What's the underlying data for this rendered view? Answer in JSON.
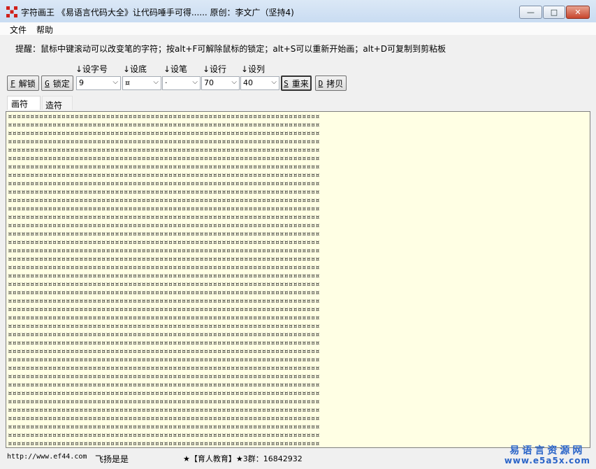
{
  "window": {
    "title": "字符画王 《易语言代码大全》让代码唾手可得...... 原创：李文广（坚持4)",
    "minimize_glyph": "—",
    "maximize_glyph": "□",
    "close_glyph": "✕"
  },
  "menu": {
    "items": [
      "文件",
      "帮助"
    ]
  },
  "hint": "提醒：鼠标中键滚动可以改变笔的字符；按alt+F可解除鼠标的锁定；alt+S可以重新开始画；alt+D可复制到剪粘板",
  "toolbar": {
    "unlock": {
      "key": "F",
      "label": "解锁"
    },
    "lock": {
      "key": "G",
      "label": "锁定"
    },
    "restart": {
      "key": "S",
      "label": "重来"
    },
    "copy": {
      "key": "D",
      "label": "拷贝"
    },
    "fields": [
      {
        "label": "↓设字号",
        "value": "9"
      },
      {
        "label": "↓设底",
        "value": "¤"
      },
      {
        "label": "↓设笔",
        "value": "·"
      },
      {
        "label": "↓设行",
        "value": "70"
      },
      {
        "label": "↓设列",
        "value": "40"
      }
    ],
    "arrow_glyph": "⌵"
  },
  "tabs": [
    "画符",
    "造符"
  ],
  "canvas": {
    "fill_char": "¤",
    "rows": 40,
    "cols": 70
  },
  "status": {
    "url": "http://www.ef44.com",
    "name": "飞扬是是",
    "group": "★【育人教育】★3群：16842932"
  },
  "watermark": {
    "cn": "易语言资源网",
    "url": "www.e5a5x.com"
  },
  "colors": {
    "canvas_bg": "#ffffe4",
    "titlebar": "#c9dcf2",
    "close": "#c8462e",
    "watermark": "#2a64c8"
  }
}
